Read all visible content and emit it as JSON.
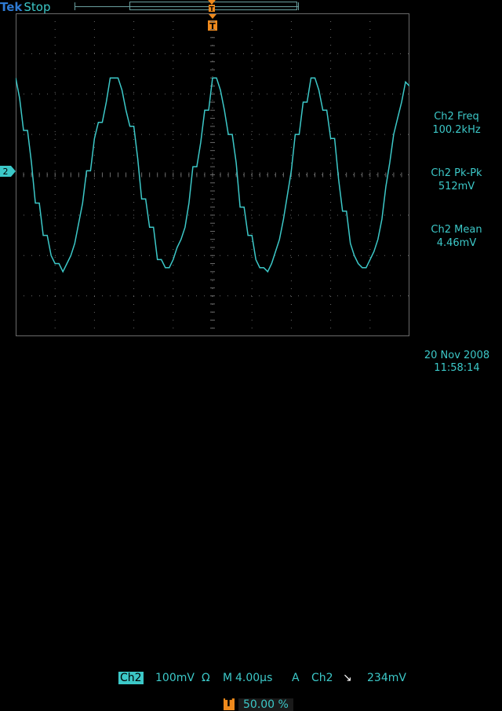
{
  "header": {
    "brand": "Tek",
    "run_state": "Stop"
  },
  "channel_marker": "2",
  "trigger_marker": "T",
  "measurements": [
    {
      "label": "Ch2 Freq",
      "value": "100.2kHz"
    },
    {
      "label": "Ch2 Pk-Pk",
      "value": "512mV"
    },
    {
      "label": "Ch2 Mean",
      "value": "4.46mV"
    }
  ],
  "status": {
    "channel": "Ch2",
    "volts_per_div": "100mV",
    "ohm_symbol": "Ω",
    "timebase_label": "M",
    "time_per_div": "4.00µs",
    "trigger_mode": "A",
    "trigger_source": "Ch2",
    "trigger_slope_symbol": "↘",
    "trigger_level": "234mV",
    "trigger_position_marker": "T",
    "trigger_position": "50.00 %"
  },
  "datetime": {
    "date": "20 Nov 2008",
    "time": "11:58:14"
  },
  "colors": {
    "trace": "#3cc8c8",
    "grid": "#6a6a6a",
    "trigger": "#f08a1c",
    "brand": "#2f7bd3"
  },
  "chart_data": {
    "type": "line",
    "title": "",
    "xlabel": "",
    "ylabel": "",
    "x_units": "µs",
    "y_units": "V",
    "xlim": [
      -20,
      20
    ],
    "ylim": [
      -0.4,
      0.4
    ],
    "grid": true,
    "series": [
      {
        "x": [
          -20,
          -19.6,
          -19.2,
          -18.8,
          -18.4,
          -18,
          -17.6,
          -17.2,
          -16.8,
          -16.4,
          -16,
          -15.6,
          -15.2,
          -14.8,
          -14.4,
          -14,
          -13.6,
          -13.2,
          -12.8,
          -12.4,
          -12,
          -11.6,
          -11.2,
          -10.8,
          -10.4,
          -10,
          -9.6,
          -9.2,
          -8.8,
          -8.4,
          -8,
          -7.6,
          -7.2,
          -6.8,
          -6.4,
          -6,
          -5.6,
          -5.2,
          -4.8,
          -4.4,
          -4,
          -3.6,
          -3.2,
          -2.8,
          -2.4,
          -2,
          -1.6,
          -1.2,
          -0.8,
          -0.4,
          0,
          0.4,
          0.8,
          1.2,
          1.6,
          2,
          2.4,
          2.8,
          3.2,
          3.6,
          4,
          4.4,
          4.8,
          5.2,
          5.6,
          6,
          6.4,
          6.8,
          7.2,
          7.6,
          8,
          8.4,
          8.8,
          9.2,
          9.6,
          10,
          10.4,
          10.8,
          11.2,
          11.6,
          12,
          12.4,
          12.8,
          13.2,
          13.6,
          14,
          14.4,
          14.8,
          15.2,
          15.6,
          16,
          16.4,
          16.8,
          17.2,
          17.6,
          18,
          18.4,
          18.8,
          19.2,
          19.6,
          20
        ],
        "y": [
          0.24,
          0.19,
          0.11,
          0.11,
          0.03,
          -0.07,
          -0.07,
          -0.15,
          -0.15,
          -0.2,
          -0.22,
          -0.22,
          -0.24,
          -0.22,
          -0.2,
          -0.17,
          -0.12,
          -0.07,
          0.01,
          0.01,
          0.09,
          0.13,
          0.13,
          0.18,
          0.24,
          0.24,
          0.24,
          0.21,
          0.16,
          0.12,
          0.12,
          0.04,
          -0.06,
          -0.06,
          -0.13,
          -0.13,
          -0.21,
          -0.21,
          -0.23,
          -0.23,
          -0.21,
          -0.18,
          -0.16,
          -0.13,
          -0.07,
          0.02,
          0.02,
          0.08,
          0.16,
          0.16,
          0.24,
          0.24,
          0.21,
          0.16,
          0.1,
          0.1,
          0.03,
          -0.08,
          -0.08,
          -0.15,
          -0.15,
          -0.21,
          -0.23,
          -0.23,
          -0.24,
          -0.22,
          -0.19,
          -0.16,
          -0.11,
          -0.05,
          0.01,
          0.1,
          0.1,
          0.18,
          0.18,
          0.24,
          0.24,
          0.21,
          0.16,
          0.16,
          0.09,
          0.09,
          -0.01,
          -0.09,
          -0.09,
          -0.17,
          -0.2,
          -0.22,
          -0.23,
          -0.23,
          -0.21,
          -0.19,
          -0.16,
          -0.11,
          -0.03,
          0.03,
          0.1,
          0.14,
          0.18,
          0.23,
          0.22
        ]
      }
    ]
  }
}
